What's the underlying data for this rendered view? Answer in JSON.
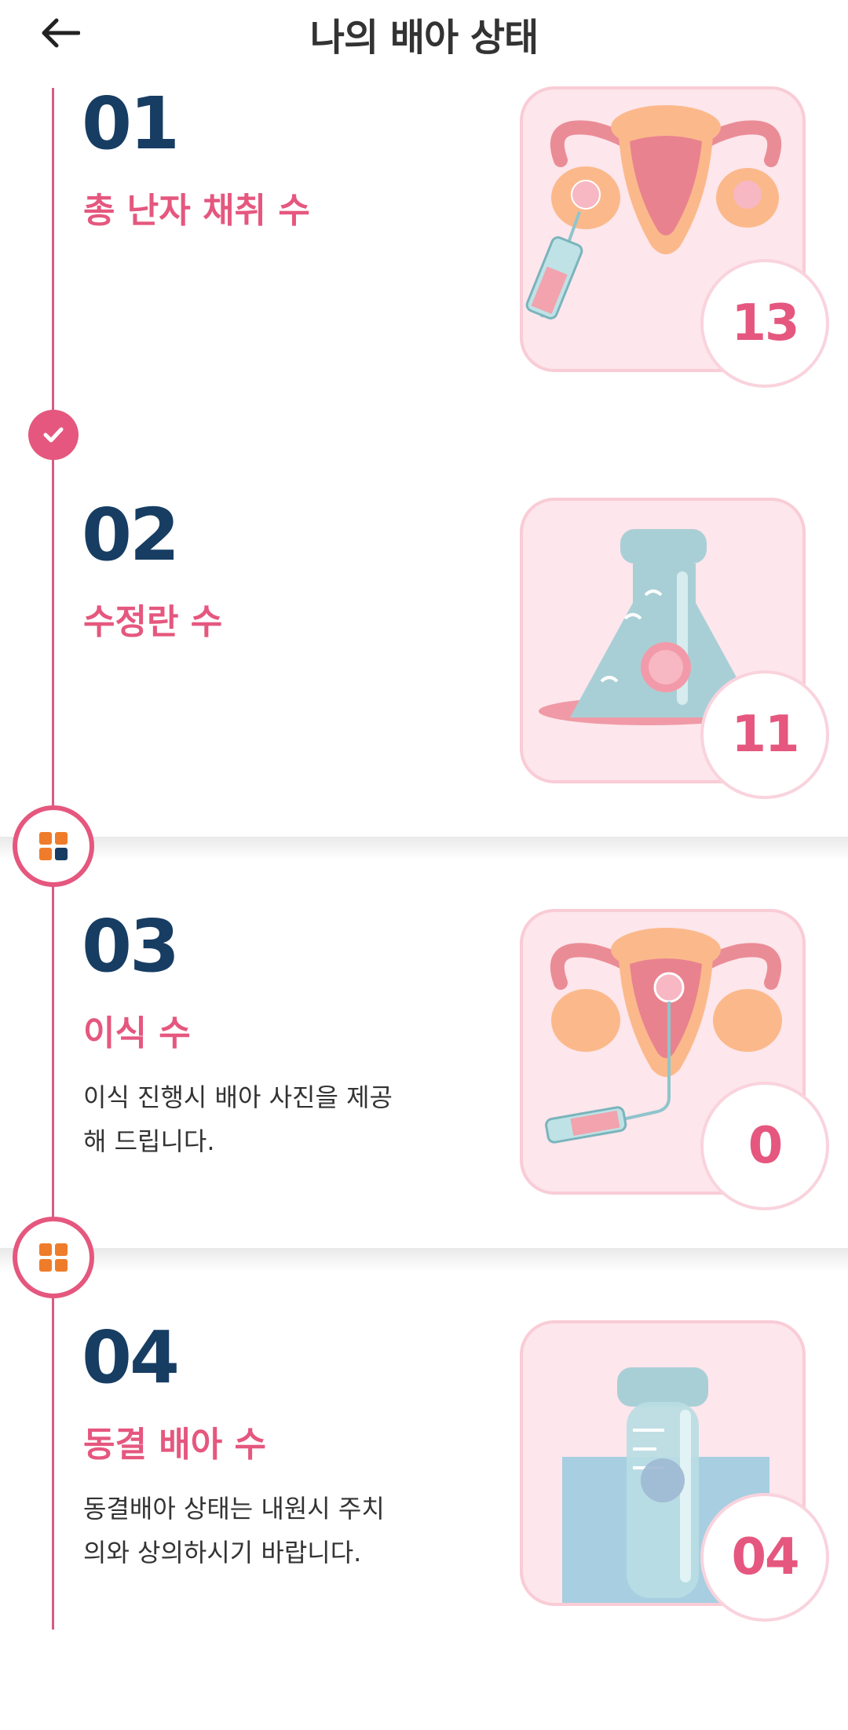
{
  "header": {
    "title": "나의 배아 상태",
    "back_icon": "arrow-left-icon"
  },
  "colors": {
    "accent": "#e5577e",
    "number": "#173d63",
    "card_bg": "#fde6ec",
    "timeline": "#d45c82"
  },
  "steps": [
    {
      "number": "01",
      "label": "총 난자 채취 수",
      "count": "13",
      "illustration": "uterus-syringe-illustration"
    },
    {
      "number": "02",
      "label": "수정란 수",
      "count": "11",
      "illustration": "flask-sperm-egg-illustration"
    },
    {
      "number": "03",
      "label": "이식 수",
      "description": "이식 진행시 배아 사진을 제공\n해 드립니다.",
      "count": "0",
      "illustration": "uterus-transfer-illustration"
    },
    {
      "number": "04",
      "label": "동결 배아 수",
      "description": "동결배아 상태는 내원시 주치\n의와 상의하시기 바랍니다.",
      "count": "04",
      "illustration": "freezing-tube-illustration"
    }
  ],
  "markers": [
    "check-icon",
    "grid-icon",
    "grid-icon"
  ]
}
